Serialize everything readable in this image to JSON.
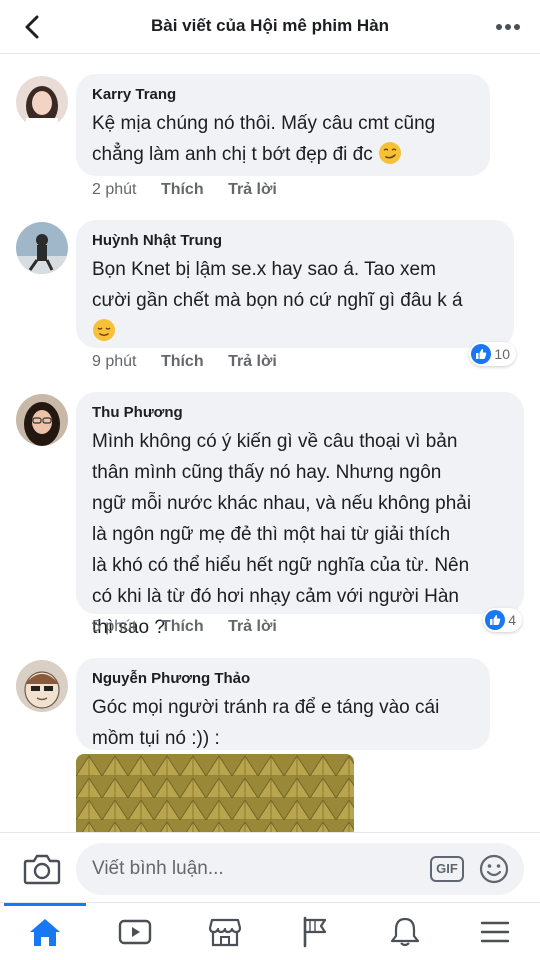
{
  "header": {
    "title": "Bài viết của Hội mê phim Hàn",
    "back_icon": "chevron-left-icon",
    "more_icon": "more-horizontal-icon"
  },
  "comments": [
    {
      "author": "Karry Trang",
      "lines": [
        "Kệ mịa chúng nó thôi. Mấy câu cmt cũng",
        "chẳng làm anh chị t bớt đẹp đi đc"
      ],
      "emoji": "smirk-emoji",
      "time": "2 phút",
      "like_label": "Thích",
      "reply_label": "Trả lời"
    },
    {
      "author": "Huỳnh Nhật Trung",
      "lines": [
        "Bọn Knet bị lậm se.x hay sao á. Tao xem",
        "cười gần chết mà bọn nó cứ nghĩ gì đâu k á"
      ],
      "emoji": "relieved-emoji",
      "time": "9 phút",
      "like_label": "Thích",
      "reply_label": "Trả lời",
      "reactions": "10"
    },
    {
      "author": "Thu Phương",
      "lines": [
        "Mình không có ý kiến gì về câu thoại vì bản",
        "thân mình cũng thấy nó hay. Nhưng ngôn",
        "ngữ mỗi nước khác nhau, và nếu không phải",
        "là ngôn ngữ mẹ đẻ thì một hai từ giải thích",
        "là khó có thể hiểu hết ngữ nghĩa của từ. Nên",
        "có khi là từ đó hơi nhạy cảm với người Hàn",
        "thì sao ?"
      ],
      "time": "5 phút",
      "like_label": "Thích",
      "reply_label": "Trả lời",
      "reactions": "4"
    },
    {
      "author": "Nguyễn Phương Thảo",
      "lines": [
        "Góc mọi người tránh ra để e táng vào cái",
        "mồm tụi nó :)) :"
      ],
      "image": "durian-photo"
    }
  ],
  "composer": {
    "placeholder": "Viết bình luận...",
    "gif_label": "GIF",
    "camera_icon": "camera-icon",
    "emoji_icon": "smiley-icon"
  },
  "bottom_nav": {
    "items": [
      "home-icon",
      "video-icon",
      "marketplace-icon",
      "pages-flag-icon",
      "notifications-bell-icon",
      "menu-icon"
    ],
    "active": "home-icon"
  },
  "colors": {
    "accent": "#1877f2",
    "bubble": "#f0f2f5",
    "meta": "#65676b"
  }
}
